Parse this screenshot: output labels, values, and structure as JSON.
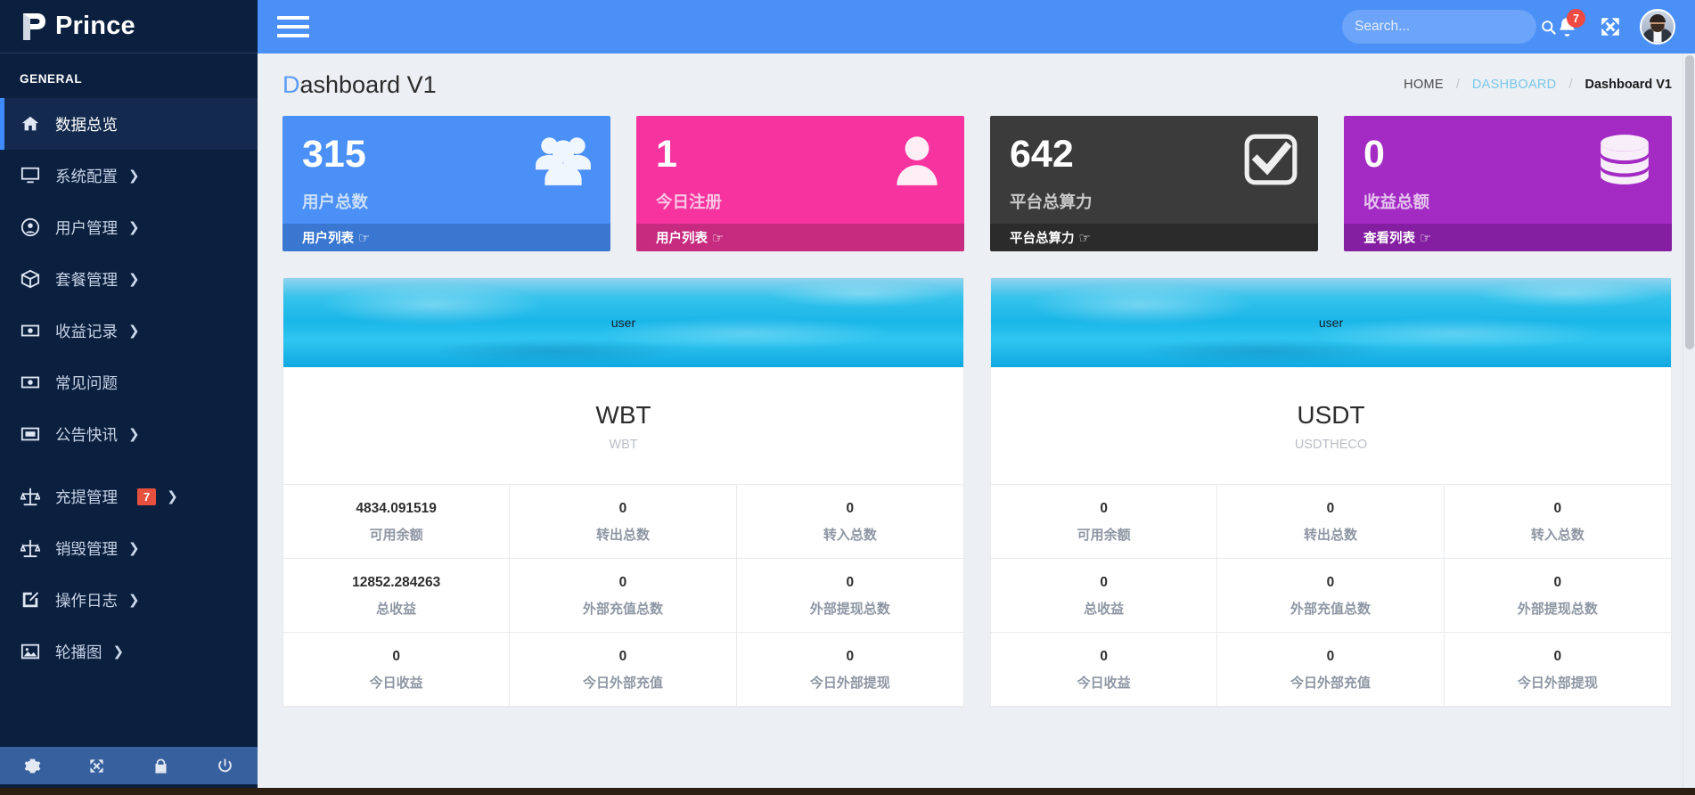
{
  "brand": {
    "name": "Prince",
    "logo_icon": "prince-p-logo-icon"
  },
  "sidebar": {
    "section_label": "GENERAL",
    "items": [
      {
        "label": "数据总览",
        "icon": "home-icon",
        "active": true,
        "caret": false,
        "badge": null
      },
      {
        "label": "系统配置",
        "icon": "monitor-icon",
        "active": false,
        "caret": true,
        "badge": null
      },
      {
        "label": "用户管理",
        "icon": "user-circle-icon",
        "active": false,
        "caret": true,
        "badge": null
      },
      {
        "label": "套餐管理",
        "icon": "box-icon",
        "active": false,
        "caret": true,
        "badge": null
      },
      {
        "label": "收益记录",
        "icon": "money-bill-icon",
        "active": false,
        "caret": true,
        "badge": null
      },
      {
        "label": "常见问题",
        "icon": "money-bill-icon",
        "active": false,
        "caret": false,
        "badge": null
      },
      {
        "label": "公告快讯",
        "icon": "window-icon",
        "active": false,
        "caret": true,
        "badge": null
      },
      {
        "label": "充提管理",
        "icon": "balance-scale-icon",
        "active": false,
        "caret": true,
        "badge": "7",
        "gap_before": true
      },
      {
        "label": "销毁管理",
        "icon": "balance-scale-icon",
        "active": false,
        "caret": true,
        "badge": null
      },
      {
        "label": "操作日志",
        "icon": "edit-square-icon",
        "active": false,
        "caret": true,
        "badge": null
      },
      {
        "label": "轮播图",
        "icon": "image-icon",
        "active": false,
        "caret": true,
        "badge": null
      }
    ],
    "footer_icons": [
      "gear-icon",
      "expand-arrows-icon",
      "lock-icon",
      "power-off-icon"
    ]
  },
  "topbar": {
    "menu_toggle_icon": "hamburger-menu-icon",
    "search": {
      "placeholder": "Search...",
      "value": "",
      "icon": "search-icon"
    },
    "notifications": {
      "icon": "bell-icon",
      "count": "7"
    },
    "fullscreen_icon": "expand-arrows-icon",
    "avatar_icon": "user-avatar"
  },
  "page": {
    "title": "Dashboard V1",
    "title_first_char": "D",
    "title_rest": "ashboard V1",
    "breadcrumb": {
      "home": "HOME",
      "parent": "DASHBOARD",
      "current": "Dashboard V1",
      "separator": "/"
    }
  },
  "stats": [
    {
      "value": "315",
      "label": "用户总数",
      "link": "用户列表",
      "icon": "users-group-icon",
      "color": "#4a90f7",
      "foot_color": "#3a77d1"
    },
    {
      "value": "1",
      "label": "今日注册",
      "link": "用户列表",
      "icon": "user-single-icon",
      "color": "#f6339e",
      "foot_color": "#c72b80"
    },
    {
      "value": "642",
      "label": "平台总算力",
      "link": "平台总算力",
      "icon": "check-square-icon",
      "color": "#3b3b3b",
      "foot_color": "#2b2b2b"
    },
    {
      "value": "0",
      "label": "收益总额",
      "link": "查看列表",
      "icon": "database-icon",
      "color": "#a32bc4",
      "foot_color": "#851fa1"
    }
  ],
  "stat_link_hand_icon": "pointing-hand-icon",
  "coins": [
    {
      "banner_text": "user",
      "title": "WBT",
      "subtitle": "WBT",
      "cells": [
        {
          "value": "4834.091519",
          "caption": "可用余额"
        },
        {
          "value": "0",
          "caption": "转出总数"
        },
        {
          "value": "0",
          "caption": "转入总数"
        },
        {
          "value": "12852.284263",
          "caption": "总收益"
        },
        {
          "value": "0",
          "caption": "外部充值总数"
        },
        {
          "value": "0",
          "caption": "外部提现总数"
        },
        {
          "value": "0",
          "caption": "今日收益"
        },
        {
          "value": "0",
          "caption": "今日外部充值"
        },
        {
          "value": "0",
          "caption": "今日外部提现"
        }
      ]
    },
    {
      "banner_text": "user",
      "title": "USDT",
      "subtitle": "USDTHECO",
      "cells": [
        {
          "value": "0",
          "caption": "可用余额"
        },
        {
          "value": "0",
          "caption": "转出总数"
        },
        {
          "value": "0",
          "caption": "转入总数"
        },
        {
          "value": "0",
          "caption": "总收益"
        },
        {
          "value": "0",
          "caption": "外部充值总数"
        },
        {
          "value": "0",
          "caption": "外部提现总数"
        },
        {
          "value": "0",
          "caption": "今日收益"
        },
        {
          "value": "0",
          "caption": "今日外部充值"
        },
        {
          "value": "0",
          "caption": "今日外部提现"
        }
      ]
    }
  ]
}
